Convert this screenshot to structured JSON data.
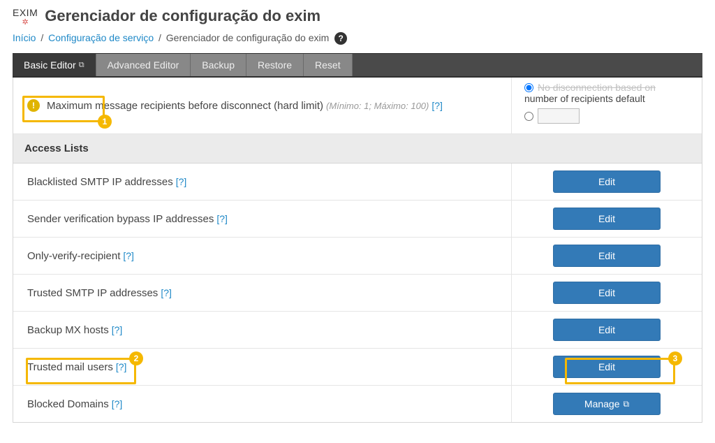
{
  "logo": "EXIM",
  "page_title": "Gerenciador de configuração do exim",
  "breadcrumb": {
    "home": "Início",
    "service_config": "Configuração de serviço",
    "current": "Gerenciador de configuração do exim"
  },
  "tabs": {
    "basic": "Basic Editor",
    "advanced": "Advanced Editor",
    "backup": "Backup",
    "restore": "Restore",
    "reset": "Reset"
  },
  "top_row": {
    "label": "Maximum message recipients before disconnect (hard limit)",
    "hint": "(Mínimo: 1; Máximo: 100)",
    "qmark": "[?]",
    "radio_cut": "No disconnection based on",
    "radio_line2": "number of recipients",
    "default": "default"
  },
  "section_header": "Access Lists",
  "rows": [
    {
      "label": "Blacklisted SMTP IP addresses",
      "qmark": "[?]",
      "button": "Edit"
    },
    {
      "label": "Sender verification bypass IP addresses",
      "qmark": "[?]",
      "button": "Edit"
    },
    {
      "label": "Only-verify-recipient",
      "qmark": "[?]",
      "button": "Edit"
    },
    {
      "label": "Trusted SMTP IP addresses",
      "qmark": "[?]",
      "button": "Edit"
    },
    {
      "label": "Backup MX hosts",
      "qmark": "[?]",
      "button": "Edit"
    },
    {
      "label": "Trusted mail users",
      "qmark": "[?]",
      "button": "Edit"
    },
    {
      "label": "Blocked Domains",
      "qmark": "[?]",
      "button": "Manage",
      "external": true
    }
  ],
  "annotations": {
    "n1": "1",
    "n2": "2",
    "n3": "3"
  }
}
